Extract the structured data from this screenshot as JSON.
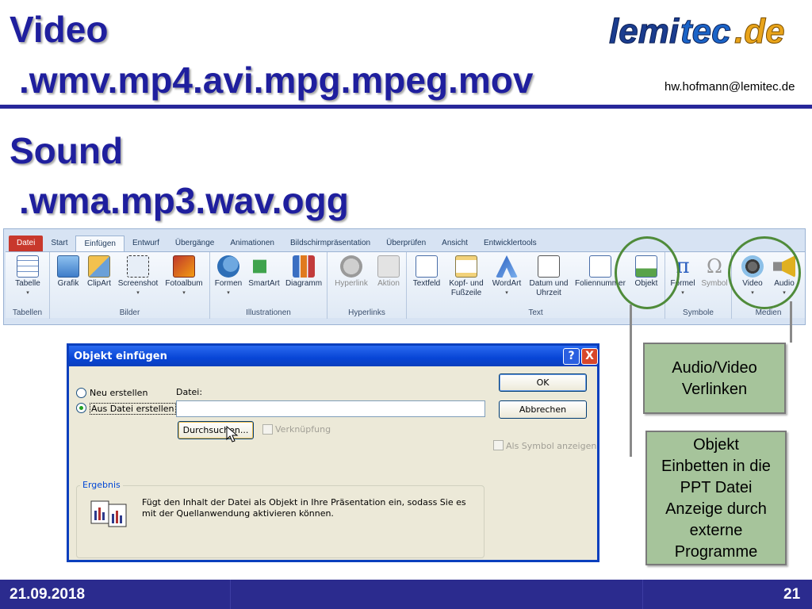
{
  "slide": {
    "title_line1": "Video",
    "title_line2": ".wmv.mp4.avi.mpg.mpeg.mov",
    "title_line3": "Sound",
    "title_line4": ".wma.mp3.wav.ogg",
    "logo_text": "lemitec.de",
    "email": "hw.hofmann@lemitec.de"
  },
  "ribbon": {
    "tabs": [
      "Datei",
      "Start",
      "Einfügen",
      "Entwurf",
      "Übergänge",
      "Animationen",
      "Bildschirmpräsentation",
      "Überprüfen",
      "Ansicht",
      "Entwicklertools"
    ],
    "groups": {
      "tabellen": "Tabellen",
      "bilder": "Bilder",
      "illustrationen": "Illustrationen",
      "hyperlinks": "Hyperlinks",
      "text": "Text",
      "symbole": "Symbole",
      "medien": "Medien"
    },
    "buttons": {
      "tabelle": "Tabelle",
      "grafik": "Grafik",
      "clipart": "ClipArt",
      "screenshot": "Screenshot",
      "fotoalbum": "Fotoalbum",
      "formen": "Formen",
      "smartart": "SmartArt",
      "diagramm": "Diagramm",
      "hyperlink": "Hyperlink",
      "aktion": "Aktion",
      "textfeld": "Textfeld",
      "kopf_fusszeile_1": "Kopf- und",
      "kopf_fusszeile_2": "Fußzeile",
      "wordart": "WordArt",
      "datum_1": "Datum und",
      "datum_2": "Uhrzeit",
      "foliennummer": "Foliennummer",
      "objekt": "Objekt",
      "formel": "Formel",
      "symbol": "Symbol",
      "video": "Video",
      "audio": "Audio"
    }
  },
  "dialog": {
    "title": "Objekt einfügen",
    "help": "?",
    "close": "X",
    "radio_new": "Neu erstellen",
    "radio_from_file": "Aus Datei erstellen",
    "file_label": "Datei:",
    "file_value": "",
    "browse": "Durchsuchen...",
    "link": "Verknüpfung",
    "as_symbol": "Als Symbol anzeigen",
    "ok": "OK",
    "cancel": "Abbrechen",
    "result_label": "Ergebnis",
    "result_text": "Fügt den Inhalt der Datei als Objekt in Ihre Präsentation ein, sodass Sie es mit der Quellanwendung aktivieren können."
  },
  "notes": {
    "audio_video_line1": "Audio/Video",
    "audio_video_line2": "Verlinken",
    "embed_line1": "Objekt",
    "embed_line2": "Einbetten in die",
    "embed_line3": "PPT Datei",
    "embed_line4": "Anzeige durch",
    "embed_line5": "externe",
    "embed_line6": "Programme"
  },
  "footer": {
    "date": "21.09.2018",
    "page": "21"
  },
  "colors": {
    "title": "#1f1f9e",
    "footer_bg": "#2b2b8e",
    "note_bg": "#a6c49b",
    "ring": "#4f8b3a",
    "xp_title": "#0a3fbd"
  }
}
